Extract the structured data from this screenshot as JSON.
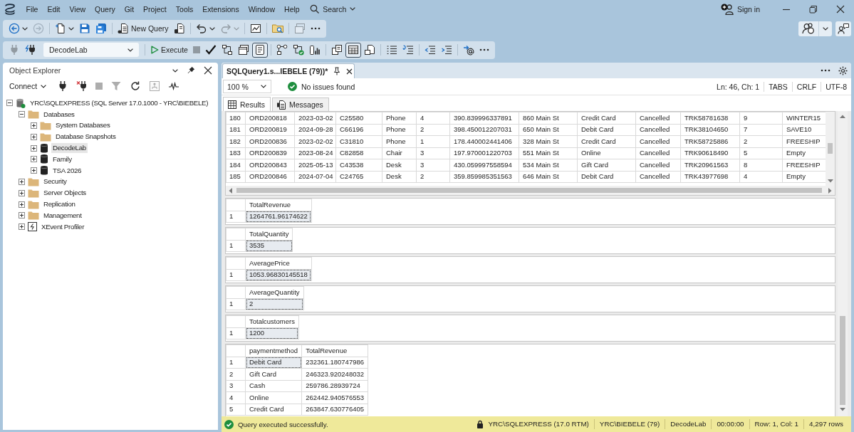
{
  "title_bar": {
    "menu": [
      "File",
      "Edit",
      "View",
      "Query",
      "Git",
      "Project",
      "Tools",
      "Extensions",
      "Window",
      "Help"
    ],
    "search": "Search",
    "sign_in": "Sign in"
  },
  "toolbar": {
    "groups": [
      {
        "buttons": [
          {
            "disabled": false,
            "dropdown": true
          },
          {
            "disabled": true,
            "dropdown": false
          }
        ]
      },
      {
        "buttons": [
          {
            "disabled": false,
            "dropdown": true
          },
          {
            "disabled": false,
            "dropdown": false
          },
          {
            "disabled": false,
            "dropdown": false
          }
        ]
      },
      {
        "buttons": [
          {
            "label": "New Query",
            "disabled": false,
            "dropdown": false
          },
          {
            "disabled": false,
            "dropdown": false
          }
        ]
      },
      {
        "buttons": [
          {
            "disabled": false,
            "dropdown": true
          },
          {
            "disabled": true,
            "dropdown": true
          }
        ]
      },
      {
        "buttons": [
          {
            "disabled": false,
            "dropdown": false
          }
        ]
      },
      {
        "buttons": [
          {
            "disabled": false,
            "dropdown": false
          }
        ]
      },
      {
        "buttons": [
          {
            "disabled": true,
            "dropdown": false
          },
          {
            "disabled": false,
            "dropdown": false
          }
        ]
      }
    ]
  },
  "query_toolbar": {
    "connection_buttons": [
      {
        "disabled": true
      },
      {
        "disabled": false
      }
    ],
    "database": "DecodeLab",
    "groups": [
      {
        "buttons": [
          {
            "label": "Execute",
            "disabled": false,
            "on": false
          },
          {
            "disabled": true,
            "on": false
          },
          {
            "disabled": false,
            "on": false
          },
          {
            "disabled": false,
            "on": false
          },
          {
            "disabled": false,
            "on": false
          },
          {
            "disabled": false,
            "on": true
          }
        ]
      },
      {
        "buttons": [
          {
            "disabled": false,
            "on": false
          },
          {
            "disabled": false,
            "on": false
          },
          {
            "disabled": false,
            "on": false
          }
        ]
      },
      {
        "buttons": [
          {
            "disabled": false,
            "on": false
          },
          {
            "disabled": false,
            "on": true
          },
          {
            "disabled": false,
            "on": false
          }
        ]
      },
      {
        "buttons": [
          {
            "disabled": false,
            "on": false
          },
          {
            "disabled": false,
            "on": false
          }
        ]
      },
      {
        "buttons": [
          {
            "disabled": false,
            "on": false
          },
          {
            "disabled": false,
            "on": false
          }
        ]
      },
      {
        "buttons": [
          {
            "disabled": false,
            "on": false
          },
          {
            "disabled": false,
            "on": false
          }
        ]
      }
    ]
  },
  "object_explorer": {
    "title": "Object Explorer",
    "connect": "Connect",
    "tools": [
      {
        "disabled": false
      },
      {
        "disabled": false
      },
      {
        "disabled": true
      },
      {
        "disabled": true
      },
      {
        "disabled": false
      },
      {
        "disabled": true
      },
      {
        "disabled": false
      }
    ],
    "tree": [
      {
        "label": "YRC\\SQLEXPRESS (SQL Server 17.0.1000 - YRC\\BIEBELE)",
        "kind": "server",
        "expanded": true,
        "selected": false,
        "children": [
          {
            "label": "Databases",
            "kind": "folder",
            "expanded": true,
            "selected": false,
            "children": [
              {
                "label": "System Databases",
                "kind": "folder",
                "expanded": false,
                "selected": false
              },
              {
                "label": "Database Snapshots",
                "kind": "folder",
                "expanded": false,
                "selected": false
              },
              {
                "label": "DecodeLab",
                "kind": "database",
                "expanded": false,
                "selected": true
              },
              {
                "label": "Family",
                "kind": "database",
                "expanded": false,
                "selected": false
              },
              {
                "label": "TSA 2026",
                "kind": "database",
                "expanded": false,
                "selected": false
              }
            ]
          },
          {
            "label": "Security",
            "kind": "folder",
            "expanded": false,
            "selected": false
          },
          {
            "label": "Server Objects",
            "kind": "folder",
            "expanded": false,
            "selected": false
          },
          {
            "label": "Replication",
            "kind": "folder",
            "expanded": false,
            "selected": false
          },
          {
            "label": "Management",
            "kind": "folder",
            "expanded": false,
            "selected": false
          },
          {
            "label": "XEvent Profiler",
            "kind": "profiler",
            "expanded": false,
            "selected": false
          }
        ]
      }
    ]
  },
  "editor": {
    "tabs": [
      {
        "title": "SQLQuery1.s...IEBELE (79))*",
        "selected": true
      }
    ],
    "zoom": "100 %",
    "issues": "No issues found",
    "status": [
      "Ln: 46, Ch: 1",
      "TABS",
      "CRLF",
      "UTF-8"
    ]
  },
  "results": {
    "tabs": [
      {
        "label": "Results",
        "selected": true
      },
      {
        "label": "Messages",
        "selected": false
      }
    ],
    "grids": [
      {
        "kind": "scrolled",
        "rows": [
          {
            "number": "180",
            "cells": [
              "ORD200818",
              "2023-03-02",
              "C25580",
              "Phone",
              "4",
              "390.839996337891",
              "860 Main St",
              "Credit Card",
              "Cancelled",
              "TRK58781638",
              "9",
              "WINTER15"
            ]
          },
          {
            "number": "181",
            "cells": [
              "ORD200819",
              "2024-09-28",
              "C66196",
              "Phone",
              "2",
              "398.450012207031",
              "650 Main St",
              "Debit Card",
              "Cancelled",
              "TRK38104650",
              "7",
              "SAVE10"
            ]
          },
          {
            "number": "182",
            "cells": [
              "ORD200836",
              "2023-02-02",
              "C31810",
              "Phone",
              "1",
              "178.440002441406",
              "328 Main St",
              "Credit Card",
              "Cancelled",
              "TRK58725886",
              "2",
              "FREESHIP"
            ]
          },
          {
            "number": "183",
            "cells": [
              "ORD200839",
              "2023-08-24",
              "C82858",
              "Chair",
              "3",
              "197.970001220703",
              "551 Main St",
              "Online",
              "Cancelled",
              "TRK90618490",
              "5",
              "Empty"
            ]
          },
          {
            "number": "184",
            "cells": [
              "ORD200843",
              "2025-05-13",
              "C43538",
              "Desk",
              "3",
              "430.059997558594",
              "534 Main St",
              "Gift Card",
              "Cancelled",
              "TRK20961563",
              "8",
              "FREESHIP"
            ]
          },
          {
            "number": "185",
            "cells": [
              "ORD200846",
              "2024-07-04",
              "C24765",
              "Desk",
              "2",
              "359.859985351563",
              "646 Main St",
              "Debit Card",
              "Cancelled",
              "TRK43977698",
              "4",
              "Empty"
            ]
          }
        ]
      },
      {
        "kind": "fitted",
        "columns": [
          "TotalRevenue"
        ],
        "rows": [
          {
            "number": "1",
            "cells": [
              {
                "text": "1264761.96174622",
                "selected": true
              }
            ]
          }
        ]
      },
      {
        "kind": "fitted",
        "columns": [
          "TotalQuantity"
        ],
        "rows": [
          {
            "number": "1",
            "cells": [
              {
                "text": "3535",
                "selected": true
              }
            ]
          }
        ]
      },
      {
        "kind": "fitted",
        "columns": [
          "AveragePrice"
        ],
        "rows": [
          {
            "number": "1",
            "cells": [
              {
                "text": "1053.96830145518",
                "selected": true
              }
            ]
          }
        ]
      },
      {
        "kind": "fitted",
        "columns": [
          "AverageQuantity"
        ],
        "rows": [
          {
            "number": "1",
            "cells": [
              {
                "text": "2",
                "selected": true
              }
            ]
          }
        ]
      },
      {
        "kind": "fitted",
        "columns": [
          "Totalcustomers"
        ],
        "rows": [
          {
            "number": "1",
            "cells": [
              {
                "text": "1200",
                "selected": true
              }
            ]
          }
        ]
      },
      {
        "kind": "fitted",
        "columns": [
          "paymentmethod",
          "TotalRevenue"
        ],
        "rows": [
          {
            "number": "1",
            "cells": [
              {
                "text": "Debit Card",
                "selected": true
              },
              {
                "text": "232361.180747986",
                "selected": false
              }
            ]
          },
          {
            "number": "2",
            "cells": [
              {
                "text": "Gift Card",
                "selected": false
              },
              {
                "text": "246323.920248032",
                "selected": false
              }
            ]
          },
          {
            "number": "3",
            "cells": [
              {
                "text": "Cash",
                "selected": false
              },
              {
                "text": "259786.28939724",
                "selected": false
              }
            ]
          },
          {
            "number": "4",
            "cells": [
              {
                "text": "Online",
                "selected": false
              },
              {
                "text": "262442.940576553",
                "selected": false
              }
            ]
          },
          {
            "number": "5",
            "cells": [
              {
                "text": "Credit Card",
                "selected": false
              },
              {
                "text": "263847.630776405",
                "selected": false
              }
            ]
          }
        ]
      }
    ]
  },
  "status_bar": {
    "message": "Query executed successfully.",
    "server": "YRC\\SQLEXPRESS (17.0 RTM)",
    "items": [
      "YRC\\BIEBELE (79)",
      "DecodeLab",
      "00:00:00",
      "Row: 1, Col: 1",
      "4,297 rows"
    ]
  }
}
